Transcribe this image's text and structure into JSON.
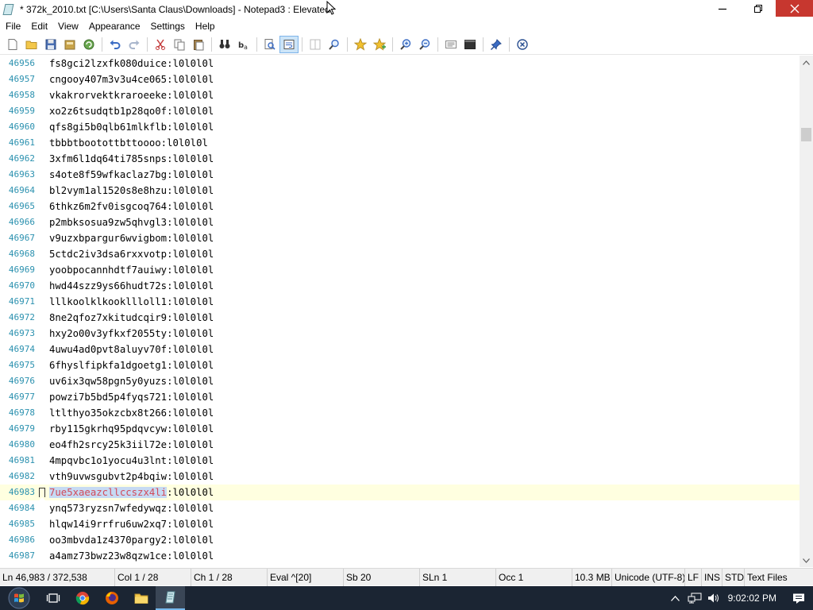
{
  "window": {
    "title": "* 372k_2010.txt [C:\\Users\\Santa Claus\\Downloads] - Notepad3 : Elevated",
    "icon": "notepad3-icon"
  },
  "menu": [
    "File",
    "Edit",
    "View",
    "Appearance",
    "Settings",
    "Help"
  ],
  "toolbar": {
    "buttons": [
      "new-file",
      "open-folder",
      "save",
      "save-as",
      "refresh",
      "undo",
      "redo",
      "cut",
      "copy",
      "paste",
      "find",
      "replace",
      "search",
      "word-wrap",
      "columns",
      "zoom-find",
      "favorite",
      "add-favorite",
      "zoom-in",
      "zoom-out",
      "select-all",
      "console",
      "pin",
      "close"
    ]
  },
  "editor": {
    "current_line_index": 27,
    "selected_text": "7ue5xaeazcllccszx4li",
    "lines": [
      {
        "no": "46956",
        "text": "fs8gci2lzxfk080duice:l0l0l0l"
      },
      {
        "no": "46957",
        "text": "cngooy407m3v3u4ce065:l0l0l0l"
      },
      {
        "no": "46958",
        "text": "vkakrorvektkraroeeke:l0l0l0l"
      },
      {
        "no": "46959",
        "text": "xo2z6tsudqtb1p28qo0f:l0l0l0l"
      },
      {
        "no": "46960",
        "text": "qfs8gi5b0qlb61mlkflb:l0l0l0l"
      },
      {
        "no": "46961",
        "text": "tbbbtbootottbttoooo:l0l0l0l"
      },
      {
        "no": "46962",
        "text": "3xfm6l1dq64ti785snps:l0l0l0l"
      },
      {
        "no": "46963",
        "text": "s4ote8f59wfkaclaz7bg:l0l0l0l"
      },
      {
        "no": "46964",
        "text": "bl2vym1al1520s8e8hzu:l0l0l0l"
      },
      {
        "no": "46965",
        "text": "6thkz6m2fv0isgcoq764:l0l0l0l"
      },
      {
        "no": "46966",
        "text": "p2mbksosua9zw5qhvgl3:l0l0l0l"
      },
      {
        "no": "46967",
        "text": "v9uzxbpargur6wvigbom:l0l0l0l"
      },
      {
        "no": "46968",
        "text": "5ctdc2iv3dsa6rxxvotp:l0l0l0l"
      },
      {
        "no": "46969",
        "text": "yoobpocannhdtf7auiwy:l0l0l0l"
      },
      {
        "no": "46970",
        "text": "hwd44szz9ys66hudt72s:l0l0l0l"
      },
      {
        "no": "46971",
        "text": "lllkoolklkookllloll1:l0l0l0l"
      },
      {
        "no": "46972",
        "text": "8ne2qfoz7xkitudcqir9:l0l0l0l"
      },
      {
        "no": "46973",
        "text": "hxy2o00v3yfkxf2055ty:l0l0l0l"
      },
      {
        "no": "46974",
        "text": "4uwu4ad0pvt8aluyv70f:l0l0l0l"
      },
      {
        "no": "46975",
        "text": "6fhyslfipkfa1dgoetg1:l0l0l0l"
      },
      {
        "no": "46976",
        "text": "uv6ix3qw58pgn5y0yuzs:l0l0l0l"
      },
      {
        "no": "46977",
        "text": "powzi7b5bd5p4fyqs721:l0l0l0l"
      },
      {
        "no": "46978",
        "text": "ltlthyo35okzcbx8t266:l0l0l0l"
      },
      {
        "no": "46979",
        "text": "rby115gkrhq95pdqvcyw:l0l0l0l"
      },
      {
        "no": "46980",
        "text": "eo4fh2srcy25k3iil72e:l0l0l0l"
      },
      {
        "no": "46981",
        "text": "4mpqvbc1o1yocu4u3lnt:l0l0l0l"
      },
      {
        "no": "46982",
        "text": "vth9uvwsgubvt2p4bqiw:l0l0l0l"
      },
      {
        "no": "46983",
        "text": ":l0l0l0l"
      },
      {
        "no": "46984",
        "text": "ynq573ryzsn7wfedywqz:l0l0l0l"
      },
      {
        "no": "46985",
        "text": "hlqw14i9rrfru6uw2xq7:l0l0l0l"
      },
      {
        "no": "46986",
        "text": "oo3mbvda1z4370pargy2:l0l0l0l"
      },
      {
        "no": "46987",
        "text": "a4amz73bwz23w8qzw1ce:l0l0l0l"
      }
    ]
  },
  "status": {
    "ln": "Ln 46,983 / 372,538",
    "col": "Col 1 / 28",
    "ch": "Ch 1 / 28",
    "eval": "Eval  ^[20]",
    "sb": "Sb  20",
    "sln": "SLn  1",
    "occ": "Occ  1",
    "size": "10.3 MB",
    "encoding": "Unicode (UTF-8)",
    "eol": "LF",
    "ins": "INS",
    "std": "STD",
    "type": "Text Files"
  },
  "taskbar": {
    "clock": "9:02:02 PM",
    "apps": [
      "task-view",
      "chrome",
      "firefox",
      "file-explorer",
      "notepad3"
    ]
  },
  "colors": {
    "line_number": "#2b91af",
    "current_line": "#ffffe0",
    "selection": "#c6daf3",
    "close_button": "#c7372f",
    "taskbar": "#1b2533"
  }
}
